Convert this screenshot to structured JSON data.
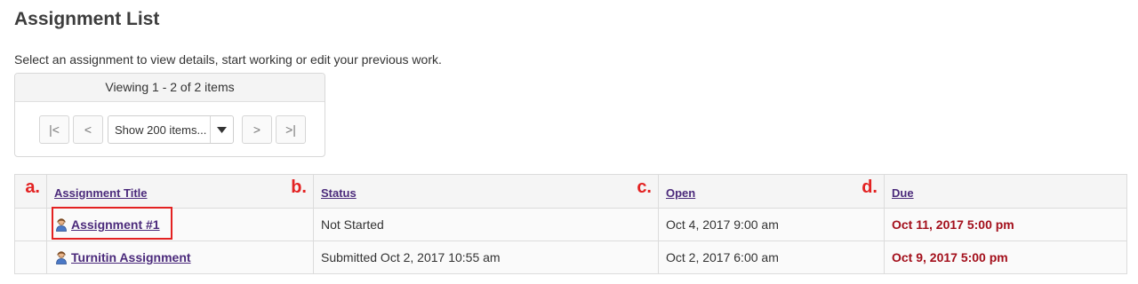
{
  "page": {
    "title": "Assignment List",
    "instructions": "Select an assignment to view details, start working or edit your previous work."
  },
  "pager": {
    "viewing": "Viewing 1 - 2 of 2 items",
    "first": "|<",
    "prev": "<",
    "page_size": "Show 200 items...",
    "next": ">",
    "last": ">|"
  },
  "table": {
    "columns": [
      {
        "label": "Assignment Title",
        "marker": "a."
      },
      {
        "label": "Status",
        "marker": "b."
      },
      {
        "label": "Open",
        "marker": "c."
      },
      {
        "label": "Due",
        "marker": "d."
      }
    ],
    "rows": [
      {
        "title": "Assignment #1",
        "status": "Not Started",
        "open": "Oct 4, 2017 9:00 am",
        "due": "Oct 11, 2017 5:00 pm"
      },
      {
        "title": "Turnitin Assignment",
        "status": "Submitted Oct 2, 2017 10:55 am",
        "open": "Oct 2, 2017 6:00 am",
        "due": "Oct 9, 2017 5:00 pm"
      }
    ]
  },
  "colors": {
    "link": "#4b2a7b",
    "due": "#a30f1b",
    "annotation": "#e32222"
  },
  "icons": {
    "assignment_icon": "person-icon",
    "dropdown_icon": "caret-down-icon"
  }
}
